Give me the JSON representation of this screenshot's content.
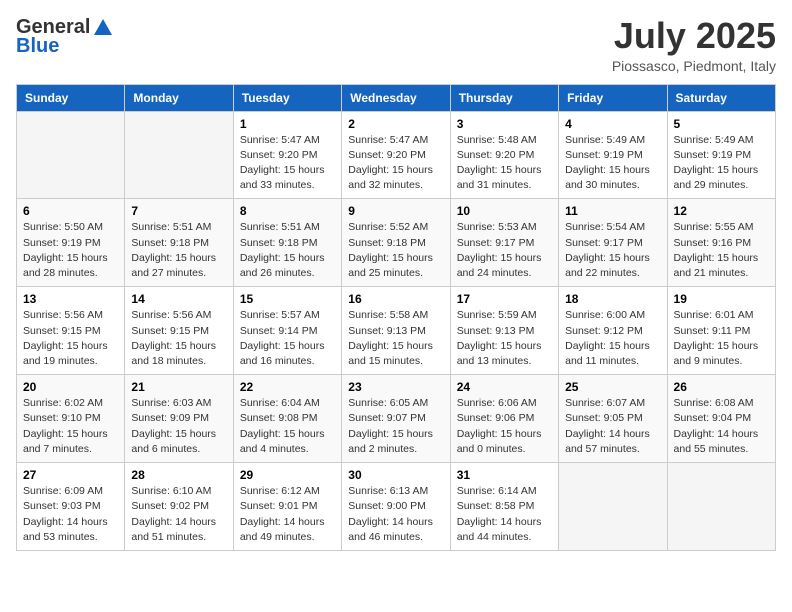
{
  "header": {
    "logo_general": "General",
    "logo_blue": "Blue",
    "title": "July 2025",
    "subtitle": "Piossasco, Piedmont, Italy"
  },
  "weekdays": [
    "Sunday",
    "Monday",
    "Tuesday",
    "Wednesday",
    "Thursday",
    "Friday",
    "Saturday"
  ],
  "weeks": [
    [
      {
        "day": "",
        "sunrise": "",
        "sunset": "",
        "daylight": ""
      },
      {
        "day": "",
        "sunrise": "",
        "sunset": "",
        "daylight": ""
      },
      {
        "day": "1",
        "sunrise": "Sunrise: 5:47 AM",
        "sunset": "Sunset: 9:20 PM",
        "daylight": "Daylight: 15 hours and 33 minutes."
      },
      {
        "day": "2",
        "sunrise": "Sunrise: 5:47 AM",
        "sunset": "Sunset: 9:20 PM",
        "daylight": "Daylight: 15 hours and 32 minutes."
      },
      {
        "day": "3",
        "sunrise": "Sunrise: 5:48 AM",
        "sunset": "Sunset: 9:20 PM",
        "daylight": "Daylight: 15 hours and 31 minutes."
      },
      {
        "day": "4",
        "sunrise": "Sunrise: 5:49 AM",
        "sunset": "Sunset: 9:19 PM",
        "daylight": "Daylight: 15 hours and 30 minutes."
      },
      {
        "day": "5",
        "sunrise": "Sunrise: 5:49 AM",
        "sunset": "Sunset: 9:19 PM",
        "daylight": "Daylight: 15 hours and 29 minutes."
      }
    ],
    [
      {
        "day": "6",
        "sunrise": "Sunrise: 5:50 AM",
        "sunset": "Sunset: 9:19 PM",
        "daylight": "Daylight: 15 hours and 28 minutes."
      },
      {
        "day": "7",
        "sunrise": "Sunrise: 5:51 AM",
        "sunset": "Sunset: 9:18 PM",
        "daylight": "Daylight: 15 hours and 27 minutes."
      },
      {
        "day": "8",
        "sunrise": "Sunrise: 5:51 AM",
        "sunset": "Sunset: 9:18 PM",
        "daylight": "Daylight: 15 hours and 26 minutes."
      },
      {
        "day": "9",
        "sunrise": "Sunrise: 5:52 AM",
        "sunset": "Sunset: 9:18 PM",
        "daylight": "Daylight: 15 hours and 25 minutes."
      },
      {
        "day": "10",
        "sunrise": "Sunrise: 5:53 AM",
        "sunset": "Sunset: 9:17 PM",
        "daylight": "Daylight: 15 hours and 24 minutes."
      },
      {
        "day": "11",
        "sunrise": "Sunrise: 5:54 AM",
        "sunset": "Sunset: 9:17 PM",
        "daylight": "Daylight: 15 hours and 22 minutes."
      },
      {
        "day": "12",
        "sunrise": "Sunrise: 5:55 AM",
        "sunset": "Sunset: 9:16 PM",
        "daylight": "Daylight: 15 hours and 21 minutes."
      }
    ],
    [
      {
        "day": "13",
        "sunrise": "Sunrise: 5:56 AM",
        "sunset": "Sunset: 9:15 PM",
        "daylight": "Daylight: 15 hours and 19 minutes."
      },
      {
        "day": "14",
        "sunrise": "Sunrise: 5:56 AM",
        "sunset": "Sunset: 9:15 PM",
        "daylight": "Daylight: 15 hours and 18 minutes."
      },
      {
        "day": "15",
        "sunrise": "Sunrise: 5:57 AM",
        "sunset": "Sunset: 9:14 PM",
        "daylight": "Daylight: 15 hours and 16 minutes."
      },
      {
        "day": "16",
        "sunrise": "Sunrise: 5:58 AM",
        "sunset": "Sunset: 9:13 PM",
        "daylight": "Daylight: 15 hours and 15 minutes."
      },
      {
        "day": "17",
        "sunrise": "Sunrise: 5:59 AM",
        "sunset": "Sunset: 9:13 PM",
        "daylight": "Daylight: 15 hours and 13 minutes."
      },
      {
        "day": "18",
        "sunrise": "Sunrise: 6:00 AM",
        "sunset": "Sunset: 9:12 PM",
        "daylight": "Daylight: 15 hours and 11 minutes."
      },
      {
        "day": "19",
        "sunrise": "Sunrise: 6:01 AM",
        "sunset": "Sunset: 9:11 PM",
        "daylight": "Daylight: 15 hours and 9 minutes."
      }
    ],
    [
      {
        "day": "20",
        "sunrise": "Sunrise: 6:02 AM",
        "sunset": "Sunset: 9:10 PM",
        "daylight": "Daylight: 15 hours and 7 minutes."
      },
      {
        "day": "21",
        "sunrise": "Sunrise: 6:03 AM",
        "sunset": "Sunset: 9:09 PM",
        "daylight": "Daylight: 15 hours and 6 minutes."
      },
      {
        "day": "22",
        "sunrise": "Sunrise: 6:04 AM",
        "sunset": "Sunset: 9:08 PM",
        "daylight": "Daylight: 15 hours and 4 minutes."
      },
      {
        "day": "23",
        "sunrise": "Sunrise: 6:05 AM",
        "sunset": "Sunset: 9:07 PM",
        "daylight": "Daylight: 15 hours and 2 minutes."
      },
      {
        "day": "24",
        "sunrise": "Sunrise: 6:06 AM",
        "sunset": "Sunset: 9:06 PM",
        "daylight": "Daylight: 15 hours and 0 minutes."
      },
      {
        "day": "25",
        "sunrise": "Sunrise: 6:07 AM",
        "sunset": "Sunset: 9:05 PM",
        "daylight": "Daylight: 14 hours and 57 minutes."
      },
      {
        "day": "26",
        "sunrise": "Sunrise: 6:08 AM",
        "sunset": "Sunset: 9:04 PM",
        "daylight": "Daylight: 14 hours and 55 minutes."
      }
    ],
    [
      {
        "day": "27",
        "sunrise": "Sunrise: 6:09 AM",
        "sunset": "Sunset: 9:03 PM",
        "daylight": "Daylight: 14 hours and 53 minutes."
      },
      {
        "day": "28",
        "sunrise": "Sunrise: 6:10 AM",
        "sunset": "Sunset: 9:02 PM",
        "daylight": "Daylight: 14 hours and 51 minutes."
      },
      {
        "day": "29",
        "sunrise": "Sunrise: 6:12 AM",
        "sunset": "Sunset: 9:01 PM",
        "daylight": "Daylight: 14 hours and 49 minutes."
      },
      {
        "day": "30",
        "sunrise": "Sunrise: 6:13 AM",
        "sunset": "Sunset: 9:00 PM",
        "daylight": "Daylight: 14 hours and 46 minutes."
      },
      {
        "day": "31",
        "sunrise": "Sunrise: 6:14 AM",
        "sunset": "Sunset: 8:58 PM",
        "daylight": "Daylight: 14 hours and 44 minutes."
      },
      {
        "day": "",
        "sunrise": "",
        "sunset": "",
        "daylight": ""
      },
      {
        "day": "",
        "sunrise": "",
        "sunset": "",
        "daylight": ""
      }
    ]
  ]
}
